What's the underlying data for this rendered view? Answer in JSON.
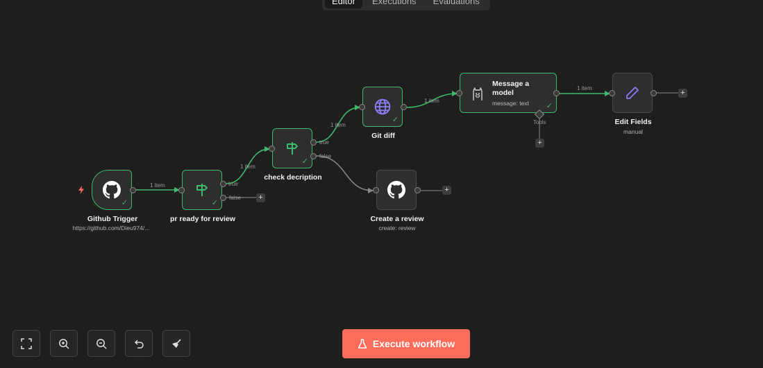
{
  "tabs": [
    {
      "label": "Editor",
      "active": true
    },
    {
      "label": "Executions",
      "active": false
    },
    {
      "label": "Evaluations",
      "active": false
    }
  ],
  "nodes": {
    "github_trigger": {
      "title": "Github Trigger",
      "subtitle": "https://github.com/Dieu974/..."
    },
    "pr_ready": {
      "title": "pr ready for review"
    },
    "check_description": {
      "title": "check decription"
    },
    "git_diff": {
      "title": "Git diff"
    },
    "message_model": {
      "title": "Message a model",
      "subtitle": "message: text",
      "tools_label": "Tools"
    },
    "edit_fields": {
      "title": "Edit Fields",
      "subtitle": "manual"
    },
    "create_review": {
      "title": "Create a review",
      "subtitle": "create: review"
    }
  },
  "edge_labels": {
    "item": "1 item",
    "true": "true",
    "false": "false"
  },
  "toolbar": {
    "fit_icon": "fit-view-icon",
    "zoom_in_icon": "zoom-in-icon",
    "zoom_out_icon": "zoom-out-icon",
    "reset_icon": "undo-icon",
    "tidy_icon": "broom-icon"
  },
  "execute_button": {
    "label": "Execute workflow"
  },
  "colors": {
    "success": "#3fb96c",
    "accent": "#ff6d5a",
    "canvas": "#1e1e1e",
    "node": "#2e2e2e",
    "trigger_bolt": "#ff6d5a",
    "globe": "#8c7cf5",
    "pencil": "#8c7cf5"
  }
}
